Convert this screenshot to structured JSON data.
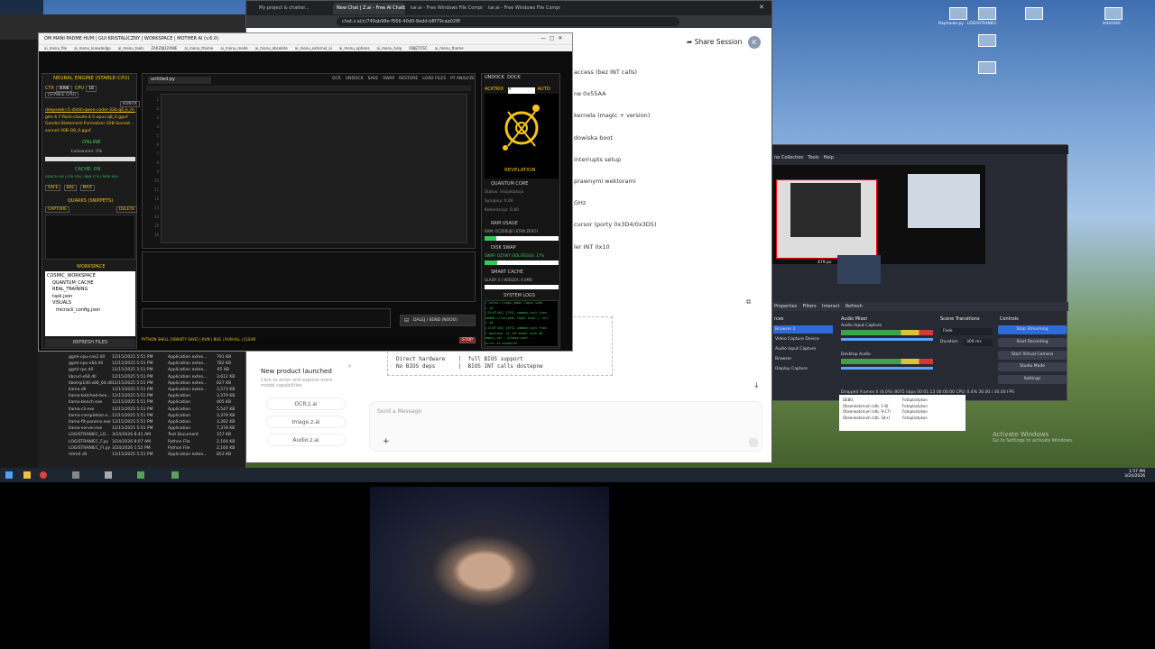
{
  "colors": {
    "accent_yellow": "#f5c518",
    "accent_green": "#38c85a",
    "obs_stream_blue": "#2f6bd8",
    "chat_blue": "#3b6fd8"
  },
  "browser": {
    "tabs": [
      "My project & chatter...",
      "New Chat | Z.ai - Free AI Chatbo...",
      "tar.ai - Free Windows File Compres...",
      "tar.ai - Free Windows File Compres..."
    ],
    "url": "chat.z.ai/c/749ab98e-f566-40d0-8add-b8f79caa028f",
    "share_label": "Share Session",
    "avatar_letter": "K",
    "chat_lines": [
      "access (bez INT calls)",
      "ne 0x55AA",
      "kernela (magic + version)",
      "dowiska boot",
      "interrupts setup",
      "prawnymi wektorami",
      "GHz",
      "cursor (porty 0x3D4/0x3D5)",
      "ler INT 0x10"
    ],
    "code_lines": [
      "No BIOS deps       |  BIOS INT calls dostepne",
      "Direct hardware    |  full BIOS support"
    ],
    "message_placeholder": "Send a Message",
    "plus": "+",
    "product_card": {
      "title": "New product launched",
      "subtitle": "Click to enter and explore more model capabilities",
      "items": [
        "OCR.z.ai",
        "Image.z.ai",
        "Audio.z.ai"
      ]
    }
  },
  "explorer": {
    "rows": [
      {
        "name": "ggml-cpu-cas2.dll",
        "date": "12/15/2025 5:51 PM",
        "type": "Application exten...",
        "size": "791 KB"
      },
      {
        "name": "ggml-cpu-x64.dll",
        "date": "12/15/2025 5:51 PM",
        "type": "Application exten...",
        "size": "782 KB"
      },
      {
        "name": "ggml-rpc.dll",
        "date": "12/15/2025 5:51 PM",
        "type": "Application exten...",
        "size": "65 KB"
      },
      {
        "name": "libcurl-x64.dll",
        "date": "12/15/2025 5:51 PM",
        "type": "Application exten...",
        "size": "3,612 KB"
      },
      {
        "name": "libomp140.x86_64.dll",
        "date": "12/15/2025 5:51 PM",
        "type": "Application exten...",
        "size": "627 KB"
      },
      {
        "name": "llama.dll",
        "date": "12/15/2025 5:51 PM",
        "type": "Application exten...",
        "size": "3,573 KB"
      },
      {
        "name": "llama-batched-ben...",
        "date": "12/15/2025 5:51 PM",
        "type": "Application",
        "size": "3,379 KB"
      },
      {
        "name": "llama-bench.exe",
        "date": "12/15/2025 5:51 PM",
        "type": "Application",
        "size": "405 KB"
      },
      {
        "name": "llama-cli.exe",
        "date": "12/15/2025 5:51 PM",
        "type": "Application",
        "size": "5,547 KB"
      },
      {
        "name": "llama-completion.e...",
        "date": "12/15/2025 5:51 PM",
        "type": "Application",
        "size": "3,379 KB"
      },
      {
        "name": "llama-fit-params.exe",
        "date": "12/15/2025 5:51 PM",
        "type": "Application",
        "size": "3,392 KB"
      },
      {
        "name": "llama-server.exe",
        "date": "12/15/2025 5:51 PM",
        "type": "Application",
        "size": "7,378 KB"
      },
      {
        "name": "LOGISTRANIEC_LO...",
        "date": "3/24/2026 8:41 AM",
        "type": "Text Document",
        "size": "157 KB"
      },
      {
        "name": "LOGISTRANIEC_F.py",
        "date": "3/24/2026 8:07 AM",
        "type": "Python File",
        "size": "2,164 KB"
      },
      {
        "name": "LOGISTRANIEC_FI.py",
        "date": "3/24/2026 1:52 PM",
        "type": "Python File",
        "size": "2,164 KB"
      },
      {
        "name": "mtmd.dll",
        "date": "12/15/2025 5:51 PM",
        "type": "Application exten...",
        "size": "853 KB"
      }
    ]
  },
  "app": {
    "title": "OM MANI PADME HUM | GUI KRISTALICZNY | WORKSPACE | MOTHER AI (v.6.0)",
    "menu": [
      "ai_menu_file",
      "ai_menu_knowledge",
      "ai_menu_tools",
      "ZARZĄDZANIE",
      "ai_menu_theme",
      "ai_menu_mode",
      "ai_menu_obsolete",
      "ai_menu_external_ai",
      "ai_menu_options",
      "ai_menu_help",
      "OBJĘTOŚĆ",
      "ai_menu_theme"
    ],
    "neural": {
      "title": "NEURAL ENGINE (STABLE-CPU)",
      "ctx_label": "CTX",
      "ctx_value": "4096",
      "cpu_label": "CPU",
      "cpu_value": "16",
      "stable": "[STABLE CPU]",
      "contr": "KONTR",
      "models": [
        "deepseek-r1-distill-qwen-coder-32b-q4_k_m.gguf",
        "glm-4.7-flash-claude-4.5-opus.q8_0.gguf",
        "Goedel-Statement-Formalizer-32B-Sonnet...",
        "sonnet-30B-Q8_0.gguf"
      ],
      "online": "ONLINE",
      "loading": "Ładowanie: 0%",
      "cache_on": "CACHE: ON",
      "cache_stats": "HEALTH: OK | CPU 33% | RAM 17% | DISK 16%",
      "safe": "SAFE",
      "bal": "BAL",
      "max": "MAX",
      "quarks": "QUARKS (SNIPPETS)",
      "capture": "CAPTURE",
      "delete": "DELETE",
      "workspace": "WORKSPACE",
      "tree": [
        "COSMIC_WORKSPACE",
        "QUANTUM_CACHE",
        "REAL_TRAINING",
        "task.json",
        "VISUALS",
        "microcli_config.json"
      ],
      "refresh": "REFRESH FILES"
    },
    "editor": {
      "tab": "untitled.py",
      "toolbar": [
        "OCR",
        "UNDOCK",
        "SAVE",
        "SWAP",
        "RESTORE",
        "LOAD FILES",
        "PY ANALYZE"
      ],
      "line_numbers": [
        "1",
        "2",
        "3",
        "4",
        "5",
        "6",
        "7",
        "8",
        "9",
        "10",
        "11",
        "12",
        "13",
        "14",
        "15",
        "16"
      ],
      "send_label": "DALEJ / SEND (NOOO)",
      "shell_bar": "PYTHON SHELL [OBIEKTY SAVE] | RUN | BUG | RUN-ALL | CLEAR",
      "stop": "STOP"
    },
    "right": {
      "undock": "UNDOCK",
      "dock": "DOCK",
      "acktrix": "ACKTRIX",
      "a_value": "A",
      "auto": "AUTO",
      "revelation": "REVELATION",
      "quantum_core": "QUANTUM CORE",
      "status": "Status: Inicjalizacja",
      "synapses": "Synapsy: 0.00",
      "coherence": "Koherencja: 0.00",
      "ram_usage": "RAM USAGE",
      "ram_line": "RAM: OCZEKUJE (STAN ZERO)",
      "disk_swap": "DISK SWAP",
      "swap_line": "SWAP: OZYWY (SOLITEGGI): 17%",
      "smart_cache": "SMART CACHE",
      "cache_line": "SLADY: 0 | WIEDZA: 0.0MB",
      "system_logs": "SYSTEM LOGS",
      "logs": [
        "> exteo </repo_name> logic side",
        "> id",
        "[13:07:04] [SYS] common_init_from_",
        "  added </fim_pad> logit bias = -inf",
        "> id",
        "[13:07:04] [SYS] common_init_from_",
        "> warning: no the model with m0",
        "  empty run , please wait ...",
        "  error is disabled"
      ]
    }
  },
  "obs": {
    "menu": [
      "ne Collection",
      "Tools",
      "Help"
    ],
    "tabs": [
      "Properties",
      "Filters",
      "Interact",
      "Refresh"
    ],
    "sections": {
      "sources": "rces",
      "mixer": "Audio Mixer",
      "transitions": "Scene Transitions",
      "controls": "Controls"
    },
    "sources": [
      "Browser 2",
      "Video Capture Device",
      "Audio Input Capture",
      "Browser",
      "Display Capture"
    ],
    "mixer": [
      {
        "name": "Audio Input Capture",
        "db": "0.0 dB"
      },
      {
        "name": "Desktop Audio",
        "db": "0.0 dB"
      }
    ],
    "transition": "Fade",
    "duration_label": "Duration",
    "duration_value": "300 ms",
    "controls": [
      "Stop Streaming",
      "Start Recording",
      "Start Virtual Camera",
      "Studio Mode",
      "Settings"
    ],
    "status": "Dropped Frames 0 (0.0%)   8075 kbps   00:01:13   00:00:00   CPU: 0.4%   30.00 / 30.00 FPS",
    "preview_label": "479 px",
    "list_rows": [
      "DEBO",
      "Obserwatorium (stb. 1-8)",
      "Obserwatorium (stb. 9-17)",
      "Obserwatorium (stb. 18+)"
    ],
    "list_vals": [
      "Fotoplastykon",
      "Fotoplastykon",
      "Fotoplastykon",
      "Fotoplastykon"
    ]
  },
  "desktop": {
    "icons": [
      "Raphaelo.py",
      "LOGISTRANIEC",
      "ROBOTYKA_S",
      "HIGHSEE"
    ],
    "activate_line1": "Activate Windows",
    "activate_line2": "Go to Settings to activate Windows.",
    "clock_time": "1:57 PM",
    "clock_date": "3/24/2026"
  }
}
